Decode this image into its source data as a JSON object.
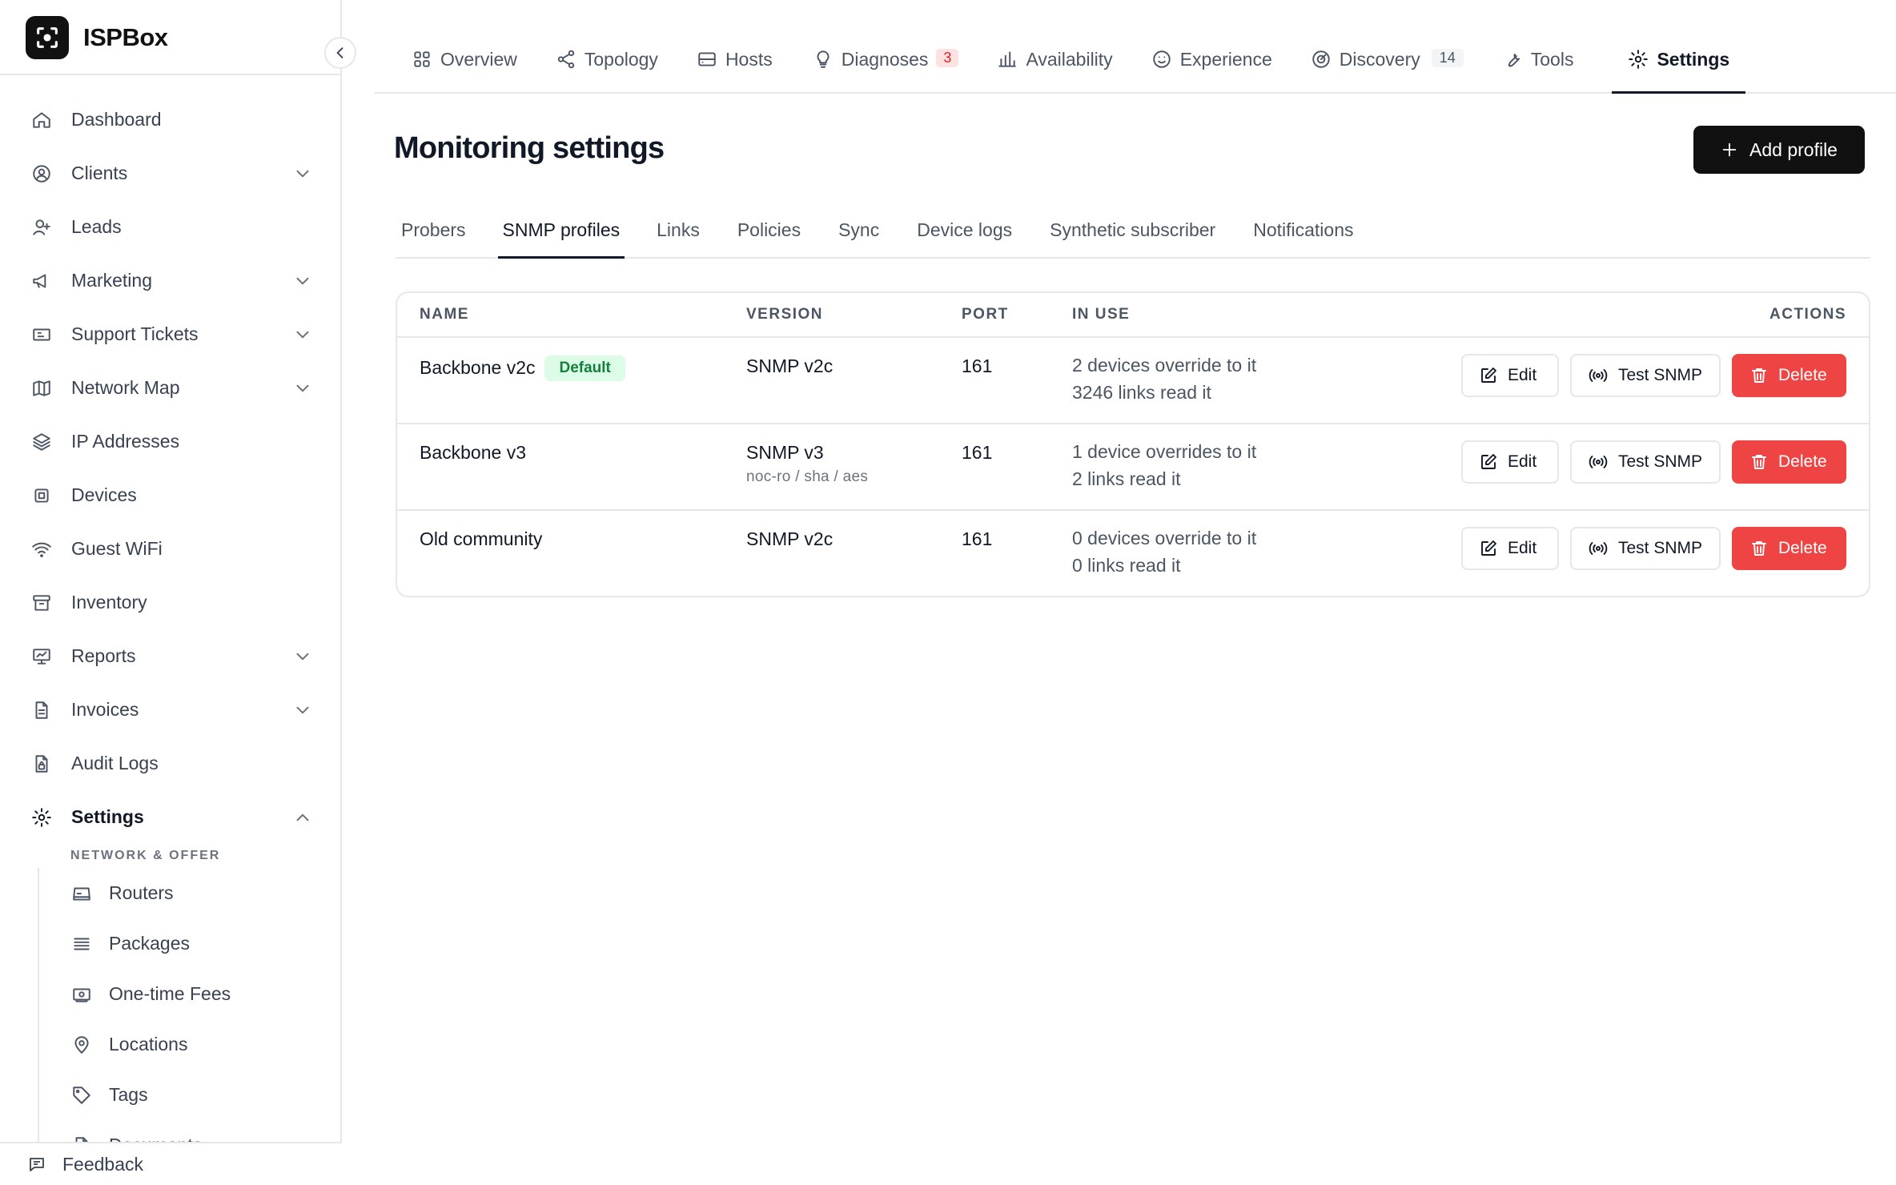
{
  "brand": {
    "name": "ISPBox"
  },
  "sidebar": {
    "items": [
      {
        "label": "Dashboard",
        "icon": "home-icon"
      },
      {
        "label": "Clients",
        "icon": "user-circle-icon",
        "expandable": true
      },
      {
        "label": "Leads",
        "icon": "user-plus-icon"
      },
      {
        "label": "Marketing",
        "icon": "megaphone-icon",
        "expandable": true
      },
      {
        "label": "Support Tickets",
        "icon": "ticket-icon",
        "expandable": true
      },
      {
        "label": "Network Map",
        "icon": "map-icon",
        "expandable": true
      },
      {
        "label": "IP Addresses",
        "icon": "layers-icon"
      },
      {
        "label": "Devices",
        "icon": "chip-icon"
      },
      {
        "label": "Guest WiFi",
        "icon": "wifi-icon"
      },
      {
        "label": "Inventory",
        "icon": "archive-icon"
      },
      {
        "label": "Reports",
        "icon": "presentation-icon",
        "expandable": true
      },
      {
        "label": "Invoices",
        "icon": "file-icon",
        "expandable": true
      },
      {
        "label": "Audit Logs",
        "icon": "file-lock-icon"
      },
      {
        "label": "Settings",
        "icon": "gear-icon",
        "expanded": true
      }
    ],
    "section_label": "NETWORK & OFFER",
    "sub_items": [
      {
        "label": "Routers",
        "icon": "router-icon"
      },
      {
        "label": "Packages",
        "icon": "list-icon"
      },
      {
        "label": "One-time Fees",
        "icon": "banknote-icon"
      },
      {
        "label": "Locations",
        "icon": "map-pin-icon"
      },
      {
        "label": "Tags",
        "icon": "tag-icon"
      },
      {
        "label": "Documents",
        "icon": "document-icon"
      }
    ],
    "feedback": "Feedback"
  },
  "topnav": {
    "tabs": [
      {
        "label": "Overview",
        "icon": "grid-icon"
      },
      {
        "label": "Topology",
        "icon": "share-icon"
      },
      {
        "label": "Hosts",
        "icon": "server-icon"
      },
      {
        "label": "Diagnoses",
        "icon": "lightbulb-icon",
        "badge": "3"
      },
      {
        "label": "Availability",
        "icon": "bar-chart-icon"
      },
      {
        "label": "Experience",
        "icon": "smile-icon"
      },
      {
        "label": "Discovery",
        "icon": "radar-icon",
        "badge": "14"
      },
      {
        "label": "Tools",
        "icon": "wrench-icon"
      },
      {
        "label": "Settings",
        "icon": "gear-icon",
        "active": true
      }
    ]
  },
  "main": {
    "title": "Monitoring settings",
    "add_button": "Add profile",
    "subtabs": [
      "Probers",
      "SNMP profiles",
      "Links",
      "Policies",
      "Sync",
      "Device logs",
      "Synthetic subscriber",
      "Notifications"
    ],
    "active_subtab": "SNMP profiles",
    "table": {
      "headers": {
        "name": "NAME",
        "version": "VERSION",
        "port": "PORT",
        "in_use": "IN USE",
        "actions": "ACTIONS"
      },
      "rows": [
        {
          "name": "Backbone v2c",
          "badge": "Default",
          "version": "SNMP v2c",
          "version_detail": "",
          "port": "161",
          "in_use_1": "2 devices override to it",
          "in_use_2": "3246 links read it"
        },
        {
          "name": "Backbone v3",
          "badge": "",
          "version": "SNMP v3",
          "version_detail": "noc-ro / sha / aes",
          "port": "161",
          "in_use_1": "1 device overrides to it",
          "in_use_2": "2 links read it"
        },
        {
          "name": "Old community",
          "badge": "",
          "version": "SNMP v2c",
          "version_detail": "",
          "port": "161",
          "in_use_1": "0 devices override to it",
          "in_use_2": "0 links read it"
        }
      ],
      "actions": {
        "edit": "Edit",
        "test": "Test SNMP",
        "delete": "Delete"
      }
    }
  },
  "colors": {
    "accent": "#111111",
    "danger": "#ef4444",
    "success_bg": "#dcfce7",
    "success_fg": "#15803d"
  }
}
